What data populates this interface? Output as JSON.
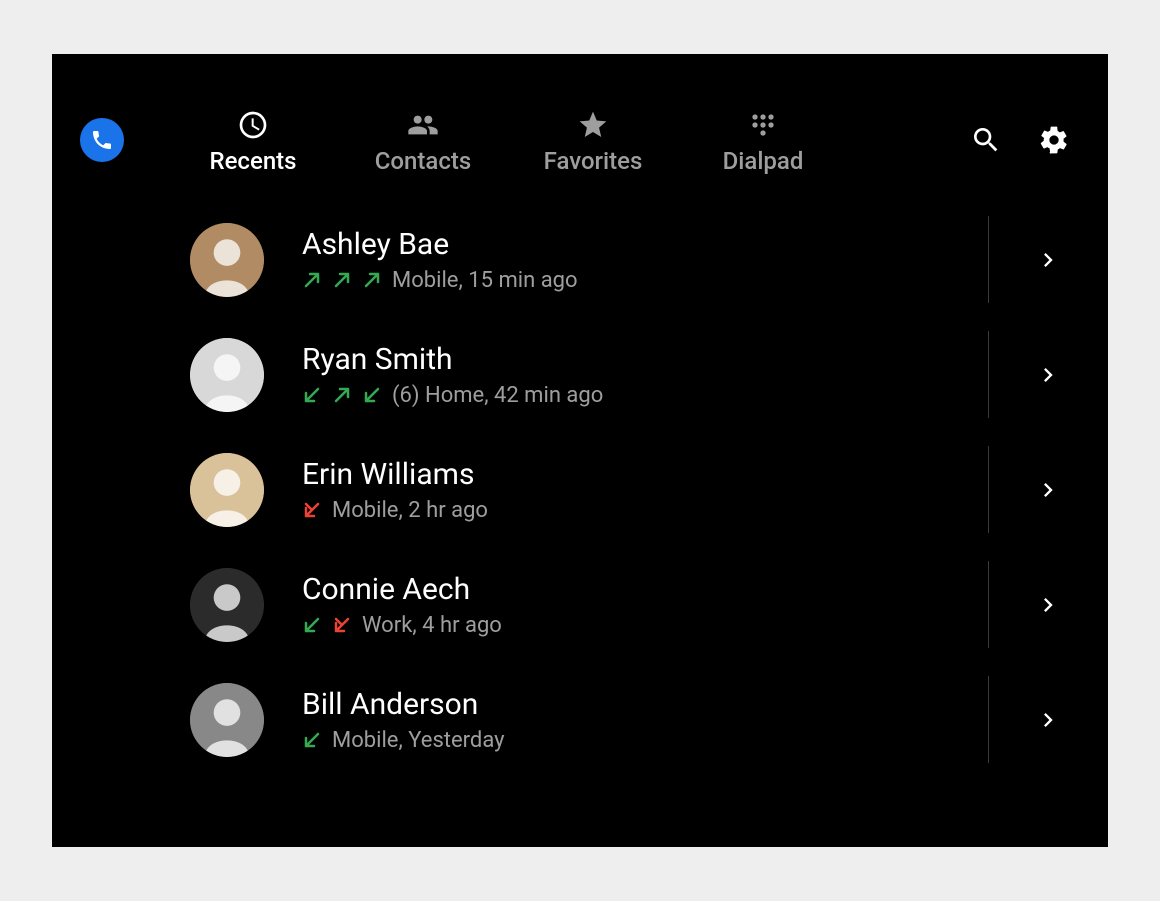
{
  "colors": {
    "accent": "#1a73e8",
    "green": "#34a853",
    "red": "#ea4335",
    "textMuted": "#9e9e9e"
  },
  "header": {
    "app_icon": "phone-icon",
    "actions": {
      "search": "search-icon",
      "settings": "gear-icon"
    }
  },
  "tabs": [
    {
      "id": "recents",
      "label": "Recents",
      "icon": "clock-icon",
      "active": true
    },
    {
      "id": "contacts",
      "label": "Contacts",
      "icon": "people-icon",
      "active": false
    },
    {
      "id": "favorites",
      "label": "Favorites",
      "icon": "star-icon",
      "active": false
    },
    {
      "id": "dialpad",
      "label": "Dialpad",
      "icon": "dialpad-icon",
      "active": false
    }
  ],
  "recents": [
    {
      "name": "Ashley Bae",
      "call_icons": [
        {
          "dir": "out",
          "status": "ok"
        },
        {
          "dir": "out",
          "status": "ok"
        },
        {
          "dir": "out",
          "status": "ok"
        }
      ],
      "count_prefix": "",
      "meta": "Mobile, 15 min ago",
      "avatar_bg": "#b08b63"
    },
    {
      "name": "Ryan Smith",
      "call_icons": [
        {
          "dir": "in",
          "status": "ok"
        },
        {
          "dir": "out",
          "status": "ok"
        },
        {
          "dir": "in",
          "status": "ok"
        }
      ],
      "count_prefix": "(6) ",
      "meta": "Home, 42 min ago",
      "avatar_bg": "#d8d8d8"
    },
    {
      "name": "Erin Williams",
      "call_icons": [
        {
          "dir": "in",
          "status": "missed"
        }
      ],
      "count_prefix": "",
      "meta": "Mobile, 2 hr ago",
      "avatar_bg": "#d9c19a"
    },
    {
      "name": "Connie Aech",
      "call_icons": [
        {
          "dir": "in",
          "status": "ok"
        },
        {
          "dir": "in",
          "status": "missed"
        }
      ],
      "count_prefix": "",
      "meta": "Work, 4 hr ago",
      "avatar_bg": "#2b2b2b"
    },
    {
      "name": "Bill Anderson",
      "call_icons": [
        {
          "dir": "in",
          "status": "ok"
        }
      ],
      "count_prefix": "",
      "meta": "Mobile, Yesterday",
      "avatar_bg": "#888888"
    }
  ]
}
